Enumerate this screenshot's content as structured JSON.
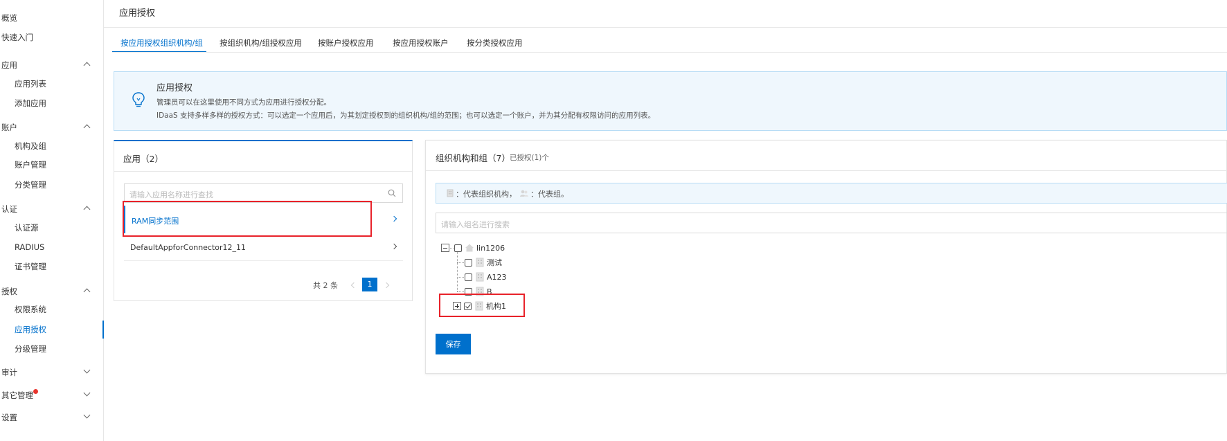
{
  "sidebar": {
    "items": [
      {
        "label": "概览",
        "level": "top"
      },
      {
        "label": "快速入门",
        "level": "top"
      },
      {
        "label": "应用",
        "level": "top",
        "chevron": "up"
      },
      {
        "label": "应用列表",
        "level": "sub"
      },
      {
        "label": "添加应用",
        "level": "sub"
      },
      {
        "label": "账户",
        "level": "top",
        "chevron": "up"
      },
      {
        "label": "机构及组",
        "level": "sub"
      },
      {
        "label": "账户管理",
        "level": "sub"
      },
      {
        "label": "分类管理",
        "level": "sub"
      },
      {
        "label": "认证",
        "level": "top",
        "chevron": "up"
      },
      {
        "label": "认证源",
        "level": "sub"
      },
      {
        "label": "RADIUS",
        "level": "sub"
      },
      {
        "label": "证书管理",
        "level": "sub"
      },
      {
        "label": "授权",
        "level": "top",
        "chevron": "up"
      },
      {
        "label": "权限系统",
        "level": "sub"
      },
      {
        "label": "应用授权",
        "level": "sub",
        "active": true
      },
      {
        "label": "分级管理",
        "level": "sub"
      },
      {
        "label": "审计",
        "level": "top",
        "chevron": "down"
      },
      {
        "label": "其它管理",
        "level": "top",
        "chevron": "down",
        "badge": "red-dot"
      },
      {
        "label": "设置",
        "level": "top",
        "chevron": "down"
      }
    ]
  },
  "header": {
    "title": "应用授权"
  },
  "tabs": [
    {
      "label": "按应用授权组织机构/组",
      "active": true
    },
    {
      "label": "按组织机构/组授权应用"
    },
    {
      "label": "按账户授权应用"
    },
    {
      "label": "按应用授权账户"
    },
    {
      "label": "按分类授权应用"
    }
  ],
  "info": {
    "icon": "lightbulb-icon",
    "title": "应用授权",
    "line1": "管理员可以在这里使用不同方式为应用进行授权分配。",
    "line2": "IDaaS 支持多样多样的授权方式：可以选定一个应用后，为其划定授权到的组织机构/组的范围；也可以选定一个账户，并为其分配有权限访问的应用列表。"
  },
  "apps_panel": {
    "title": "应用（2）",
    "search_placeholder": "请输入应用名称进行查找",
    "items": [
      {
        "name": "RAM同步范围",
        "selected": true
      },
      {
        "name": "DefaultAppforConnector12_11",
        "selected": false
      }
    ],
    "pager": {
      "total": "共 2 条",
      "current": "1"
    }
  },
  "org_panel": {
    "title": "组织机构和组（7）",
    "subtitle": "已授权(1)个",
    "legend_org": "：代表组织机构，",
    "legend_group": "：代表组。",
    "search_placeholder": "请输入组名进行搜索",
    "tree": {
      "root": {
        "label": "lin1206",
        "expanded": true,
        "checked": false
      },
      "children": [
        {
          "label": "测试",
          "checked": false
        },
        {
          "label": "A123",
          "checked": false
        },
        {
          "label": "B",
          "checked": false
        },
        {
          "label": "机构1",
          "checked": true,
          "expandable": true
        }
      ]
    },
    "save_label": "保存"
  },
  "colors": {
    "accent": "#0070cc",
    "highlight": "#e8222a",
    "info_bg": "#eff7fd"
  }
}
